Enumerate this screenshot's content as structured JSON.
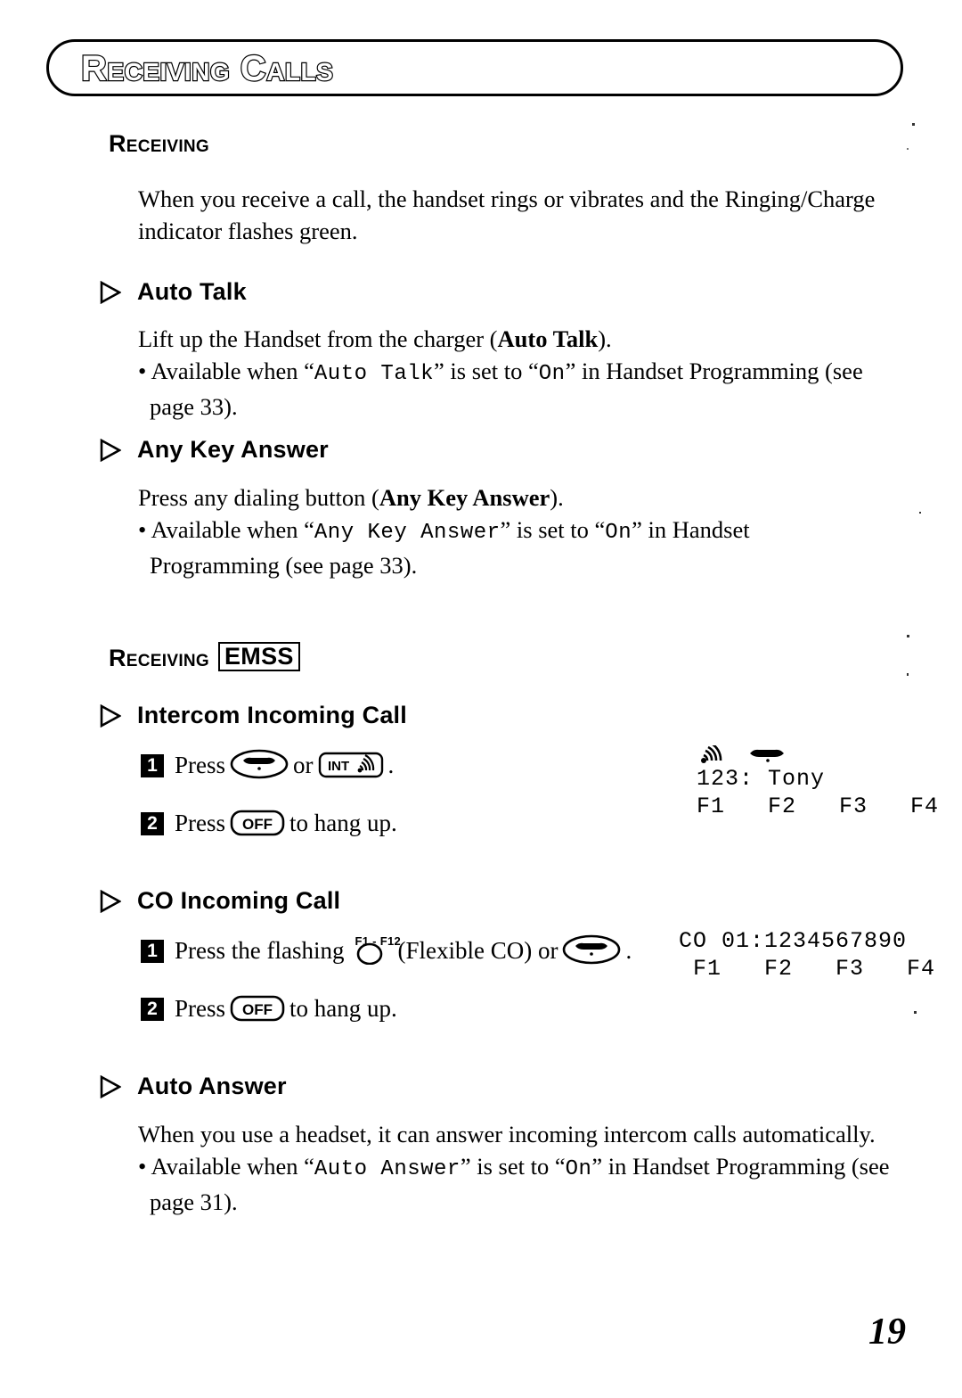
{
  "banner": {
    "title": "Receiving Calls"
  },
  "sections": {
    "receiving": {
      "heading": "Receiving",
      "paragraph": "When you receive a call, the handset rings or vibrates and the Ringing/Charge indicator flashes green."
    },
    "auto_talk": {
      "heading": "Auto Talk",
      "line1_pre": "Lift up the Handset from the charger (",
      "line1_bold": "Auto Talk",
      "line1_post": ").",
      "bullet_pre": "• Available when “",
      "bullet_mono1": "Auto Talk",
      "bullet_mid": "” is set to “",
      "bullet_mono2": "On",
      "bullet_post": "” in Handset Programming (see page 33)."
    },
    "any_key_answer": {
      "heading": "Any Key Answer",
      "line1_pre": "Press any dialing button (",
      "line1_bold": "Any Key Answer",
      "line1_post": ").",
      "bullet_pre": "• Available when “",
      "bullet_mono1": "Any Key Answer",
      "bullet_mid": "” is set to “",
      "bullet_mono2": "On",
      "bullet_post": "” in Handset Programming (see page 33)."
    },
    "receiving_emss": {
      "heading": "Receiving",
      "badge": "EMSS"
    },
    "intercom_incoming": {
      "heading": "Intercom Incoming Call",
      "step1_num": "1",
      "step1_pre": "Press",
      "step1_mid": "or",
      "step1_post": ".",
      "step2_num": "2",
      "step2_pre": "Press",
      "step2_post": "to hang up.",
      "lcd_line1": "123: Tony",
      "lcd_line2": "F1   F2   F3   F4"
    },
    "co_incoming": {
      "heading": "CO Incoming Call",
      "step1_num": "1",
      "step1_pre": "Press the flashing",
      "step1_mid": "(Flexible CO) or",
      "step1_post": ".",
      "flex_key_label": "F1 - F12",
      "step2_num": "2",
      "step2_pre": "Press",
      "step2_post": "to hang up.",
      "lcd_line1": "CO 01:1234567890",
      "lcd_line2": " F1   F2   F3   F4"
    },
    "auto_answer": {
      "heading": "Auto Answer",
      "paragraph": "When you use a headset, it can answer incoming intercom calls automatically.",
      "bullet_pre": "• Available when “",
      "bullet_mono1": "Auto Answer",
      "bullet_mid": "” is set to “",
      "bullet_mono2": "On",
      "bullet_post": "” in Handset Programming (see page 31)."
    }
  },
  "keys": {
    "talk": "talk-handset-key",
    "int": "INT",
    "off": "OFF",
    "flexible_co": "flexible-co-key"
  },
  "footer": {
    "page_number": "19"
  }
}
